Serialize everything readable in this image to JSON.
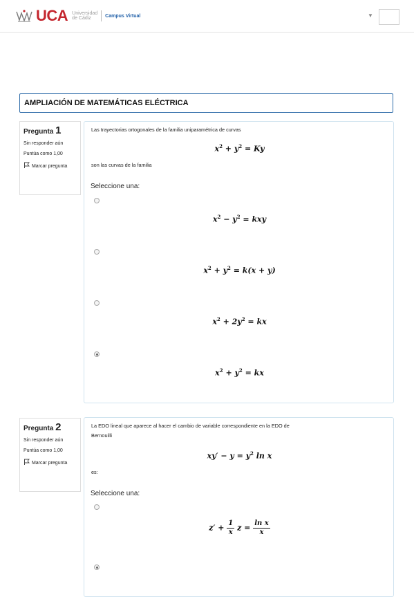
{
  "header": {
    "brand": "UCA",
    "uni_line1": "Universidad",
    "uni_line2": "de Cádiz",
    "campus": "Campus Virtual"
  },
  "course": {
    "title": "AMPLIACIÓN DE MATEMÁTICAS ELÉCTRICA"
  },
  "questions": [
    {
      "label": "Pregunta",
      "number": "1",
      "status": "Sin responder aún",
      "score": "Puntúa como 1,00",
      "flag_label": "Marcar pregunta",
      "text_before": "Las trayectorias ortogonales de la familia uniparamétrica de curvas",
      "text_after": "son las curvas de la familia",
      "select_label": "Seleccione una:",
      "options": [
        {
          "checked": false
        },
        {
          "checked": false
        },
        {
          "checked": false
        },
        {
          "checked": true
        }
      ]
    },
    {
      "label": "Pregunta",
      "number": "2",
      "status": "Sin responder aún",
      "score": "Puntúa como 1,00",
      "flag_label": "Marcar pregunta",
      "text_before_1": "La EDO lineal que aparece al hacer el cambio de variable correspondiente en la EDO de",
      "text_before_2": "Bernouilli",
      "text_after": "es:",
      "select_label": "Seleccione una:",
      "options": [
        {
          "checked": false
        },
        {
          "checked": true
        }
      ]
    }
  ],
  "colors": {
    "brand_red": "#c4262e",
    "title_border": "#2c6aa8",
    "content_border": "#cfe3ef"
  },
  "icons": {
    "crest": "uca-crest-icon",
    "flag": "flag-icon",
    "dropdown": "chevron-down-icon"
  }
}
